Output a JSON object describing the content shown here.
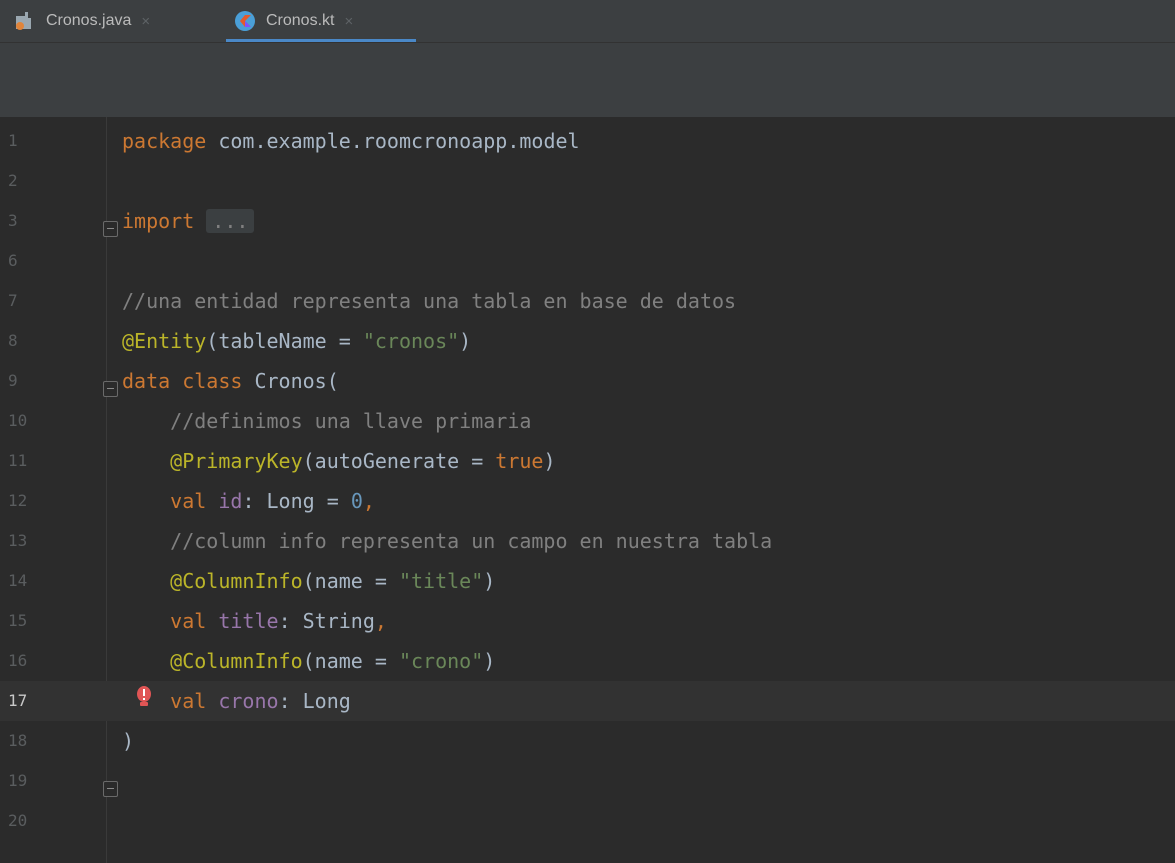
{
  "tabs": [
    {
      "label": "Cronos.java",
      "close": "×"
    },
    {
      "label": "Cronos.kt",
      "close": "×"
    }
  ],
  "editor": {
    "current_line": 17,
    "lines": [
      {
        "n": "1",
        "tokens": [
          {
            "t": "package",
            "c": "kw"
          },
          {
            "t": " com.example.roomcronoapp.model",
            "c": ""
          }
        ]
      },
      {
        "n": "2",
        "tokens": []
      },
      {
        "n": "3",
        "tokens": [
          {
            "t": "import",
            "c": "kw"
          },
          {
            "t": " ",
            "c": ""
          },
          {
            "t": "...",
            "c": "dots"
          }
        ]
      },
      {
        "n": "6",
        "tokens": []
      },
      {
        "n": "7",
        "tokens": [
          {
            "t": "//una entidad representa una tabla en base de datos",
            "c": "cm"
          }
        ]
      },
      {
        "n": "8",
        "tokens": [
          {
            "t": "@Entity",
            "c": "an"
          },
          {
            "t": "(tableName = ",
            "c": ""
          },
          {
            "t": "\"cronos\"",
            "c": "str"
          },
          {
            "t": ")",
            "c": ""
          }
        ]
      },
      {
        "n": "9",
        "tokens": [
          {
            "t": "data class",
            "c": "kw"
          },
          {
            "t": " Cronos(",
            "c": ""
          }
        ]
      },
      {
        "n": "10",
        "tokens": [
          {
            "t": "    //definimos una llave primaria",
            "c": "cm"
          }
        ]
      },
      {
        "n": "11",
        "tokens": [
          {
            "t": "    @PrimaryKey",
            "c": "an"
          },
          {
            "t": "(autoGenerate = ",
            "c": ""
          },
          {
            "t": "true",
            "c": "kw"
          },
          {
            "t": ")",
            "c": ""
          }
        ]
      },
      {
        "n": "12",
        "tokens": [
          {
            "t": "    val",
            "c": "kw"
          },
          {
            "t": " ",
            "c": ""
          },
          {
            "t": "id",
            "c": "prop"
          },
          {
            "t": ": Long = ",
            "c": ""
          },
          {
            "t": "0",
            "c": "num"
          },
          {
            "t": ",",
            "c": "kw"
          }
        ]
      },
      {
        "n": "13",
        "tokens": [
          {
            "t": "    //column info representa un campo en nuestra tabla",
            "c": "cm"
          }
        ]
      },
      {
        "n": "14",
        "tokens": [
          {
            "t": "    @ColumnInfo",
            "c": "an"
          },
          {
            "t": "(name = ",
            "c": ""
          },
          {
            "t": "\"title\"",
            "c": "str"
          },
          {
            "t": ")",
            "c": ""
          }
        ]
      },
      {
        "n": "15",
        "tokens": [
          {
            "t": "    val",
            "c": "kw"
          },
          {
            "t": " ",
            "c": ""
          },
          {
            "t": "title",
            "c": "prop"
          },
          {
            "t": ": String",
            "c": ""
          },
          {
            "t": ",",
            "c": "kw"
          }
        ]
      },
      {
        "n": "16",
        "tokens": [
          {
            "t": "    @ColumnInfo",
            "c": "an"
          },
          {
            "t": "(name = ",
            "c": ""
          },
          {
            "t": "\"crono\"",
            "c": "str"
          },
          {
            "t": ")",
            "c": ""
          }
        ]
      },
      {
        "n": "17",
        "tokens": [
          {
            "t": "    val",
            "c": "kw"
          },
          {
            "t": " ",
            "c": ""
          },
          {
            "t": "crono",
            "c": "prop"
          },
          {
            "t": ": Long",
            "c": ""
          }
        ]
      },
      {
        "n": "18",
        "tokens": [
          {
            "t": ")",
            "c": ""
          }
        ]
      },
      {
        "n": "19",
        "tokens": []
      },
      {
        "n": "20",
        "tokens": []
      }
    ]
  },
  "colors": {
    "keyword": "#cc7832",
    "annotation": "#bbb529",
    "string": "#6a8759",
    "comment": "#808080",
    "number": "#6897bb",
    "property": "#9876aa",
    "text": "#a9b7c6",
    "accent": "#4a88c7",
    "warning": "#e05555"
  },
  "icons": {
    "java_tab": "java-file-icon",
    "kotlin_tab": "kotlin-file-icon",
    "gutter_warning": "red-bulb-icon",
    "fold": "fold-icon"
  }
}
